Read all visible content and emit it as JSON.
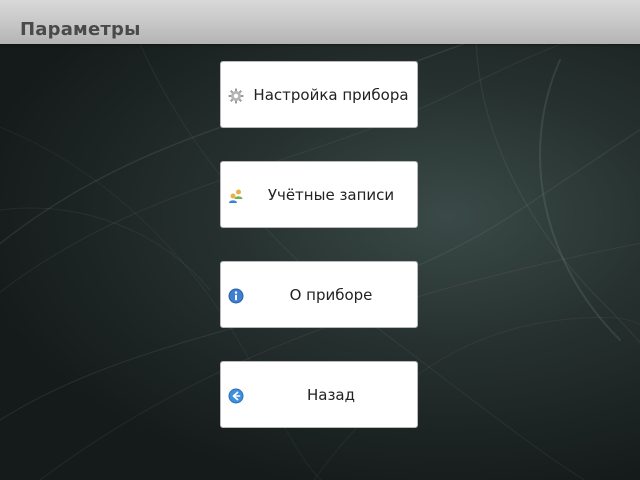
{
  "header": {
    "title": "Параметры"
  },
  "menu": {
    "items": [
      {
        "label": "Настройка прибора",
        "icon": "gear-icon"
      },
      {
        "label": "Учётные записи",
        "icon": "users-icon"
      },
      {
        "label": "О приборе",
        "icon": "info-icon"
      },
      {
        "label": "Назад",
        "icon": "back-arrow-icon"
      }
    ]
  },
  "colors": {
    "title_bar": "#c6c6c6",
    "title_text": "#4a4a4a",
    "button_bg": "#ffffff",
    "info_icon": "#3f7fd0",
    "back_icon": "#3f8fe0"
  }
}
